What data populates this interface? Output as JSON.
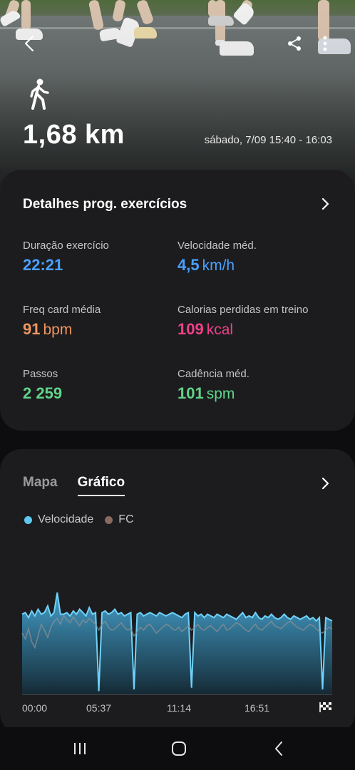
{
  "header": {
    "activity_icon": "walking-person-icon",
    "distance": "1,68 km",
    "datetime": "sábado, 7/09 15:40 - 16:03",
    "back_icon": "chevron-left-icon",
    "share_icon": "share-icon",
    "more_icon": "more-vertical-icon"
  },
  "details": {
    "title": "Detalhes prog. exercícios",
    "stats": [
      {
        "label": "Duração exercício",
        "value": "22:21",
        "unit": "",
        "color": "#4aa0ff"
      },
      {
        "label": "Velocidade méd.",
        "value": "4,5",
        "unit": "km/h",
        "color": "#4aa0ff"
      },
      {
        "label": "Freq card média",
        "value": "91",
        "unit": "bpm",
        "color": "#f0955e"
      },
      {
        "label": "Calorias perdidas em treino",
        "value": "109",
        "unit": "kcal",
        "color": "#f0408a"
      },
      {
        "label": "Passos",
        "value": "2 259",
        "unit": "",
        "color": "#62d48a"
      },
      {
        "label": "Cadência méd.",
        "value": "101",
        "unit": "spm",
        "color": "#62d48a"
      }
    ]
  },
  "chart_section": {
    "tabs": [
      {
        "label": "Mapa",
        "active": false
      },
      {
        "label": "Gráfico",
        "active": true
      }
    ],
    "legend": [
      {
        "label": "Velocidade",
        "color": "#5ec8f2"
      },
      {
        "label": "FC",
        "color": "#8a6a60"
      }
    ],
    "finish_icon": "checkered-flag-icon"
  },
  "chart_data": {
    "type": "area",
    "x_tick_labels": [
      "00:00",
      "05:37",
      "11:14",
      "16:51"
    ],
    "series": [
      {
        "name": "Velocidade",
        "values": [
          4.8,
          4.9,
          4.6,
          5.0,
          4.7,
          5.1,
          4.8,
          4.9,
          5.3,
          4.7,
          4.9,
          6.1,
          4.8,
          4.8,
          4.9,
          4.7,
          5.0,
          4.8,
          5.1,
          4.9,
          4.7,
          5.2,
          4.8,
          4.9,
          0.2,
          4.9,
          5.0,
          4.8,
          4.9,
          5.1,
          4.8,
          4.9,
          4.7,
          4.8,
          4.9,
          0.3,
          4.8,
          4.9,
          4.7,
          4.8,
          4.9,
          4.8,
          4.7,
          4.9,
          4.8,
          4.7,
          4.8,
          4.9,
          4.8,
          4.7,
          4.6,
          4.8,
          4.9,
          0.4,
          4.9,
          4.7,
          4.8,
          4.6,
          4.8,
          4.7,
          4.6,
          4.8,
          4.7,
          4.6,
          4.8,
          4.7,
          4.6,
          4.5,
          4.7,
          4.9,
          4.6,
          4.7,
          4.6,
          4.9,
          4.6,
          4.5,
          4.7,
          4.6,
          4.8,
          4.6,
          4.5,
          4.6,
          4.8,
          4.6,
          4.5,
          4.7,
          4.6,
          4.5,
          4.6,
          4.7,
          4.5,
          4.6,
          4.4,
          4.6,
          0.3,
          4.6,
          4.5,
          4.4
        ]
      },
      {
        "name": "FC",
        "values": [
          82,
          78,
          85,
          76,
          72,
          80,
          88,
          84,
          79,
          86,
          90,
          92,
          88,
          94,
          91,
          89,
          93,
          90,
          87,
          91,
          89,
          92,
          90,
          88,
          84,
          88,
          90,
          86,
          84,
          85,
          87,
          89,
          86,
          84,
          85,
          80,
          83,
          86,
          84,
          87,
          88,
          85,
          82,
          84,
          86,
          88,
          87,
          85,
          84,
          86,
          83,
          85,
          87,
          84,
          86,
          88,
          85,
          84,
          86,
          87,
          85,
          83,
          86,
          88,
          84,
          85,
          87,
          89,
          88,
          86,
          84,
          83,
          86,
          88,
          85,
          84,
          86,
          88,
          90,
          87,
          86,
          85,
          87,
          89,
          90,
          88,
          86,
          85,
          84,
          86,
          88,
          87,
          85,
          83,
          82,
          84,
          86,
          85
        ]
      }
    ]
  },
  "navbar": {
    "recent_icon": "recent-apps-icon",
    "home_icon": "home-icon",
    "back_icon": "back-icon"
  }
}
